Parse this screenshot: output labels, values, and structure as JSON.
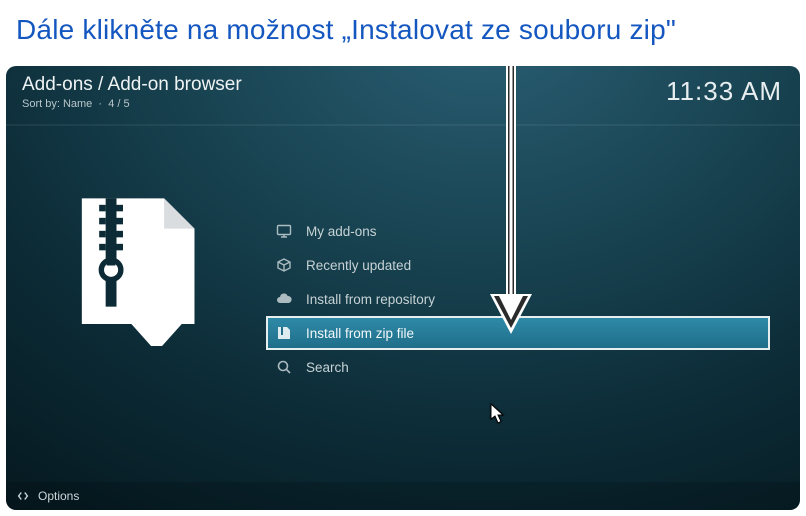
{
  "annotation": {
    "caption": "Dále klikněte na možnost „Instalovat ze souboru zip\""
  },
  "header": {
    "breadcrumb": "Add-ons / Add-on browser",
    "sort_label": "Sort by: Name",
    "page_indicator": "4 / 5",
    "clock": "11:33 AM"
  },
  "menu": {
    "items": [
      {
        "icon": "screen-icon",
        "label": "My add-ons",
        "selected": false
      },
      {
        "icon": "box-icon",
        "label": "Recently updated",
        "selected": false
      },
      {
        "icon": "cloud-icon",
        "label": "Install from repository",
        "selected": false
      },
      {
        "icon": "zip-icon",
        "label": "Install from zip file",
        "selected": true
      },
      {
        "icon": "search-icon",
        "label": "Search",
        "selected": false
      }
    ]
  },
  "footer": {
    "options_label": "Options"
  }
}
